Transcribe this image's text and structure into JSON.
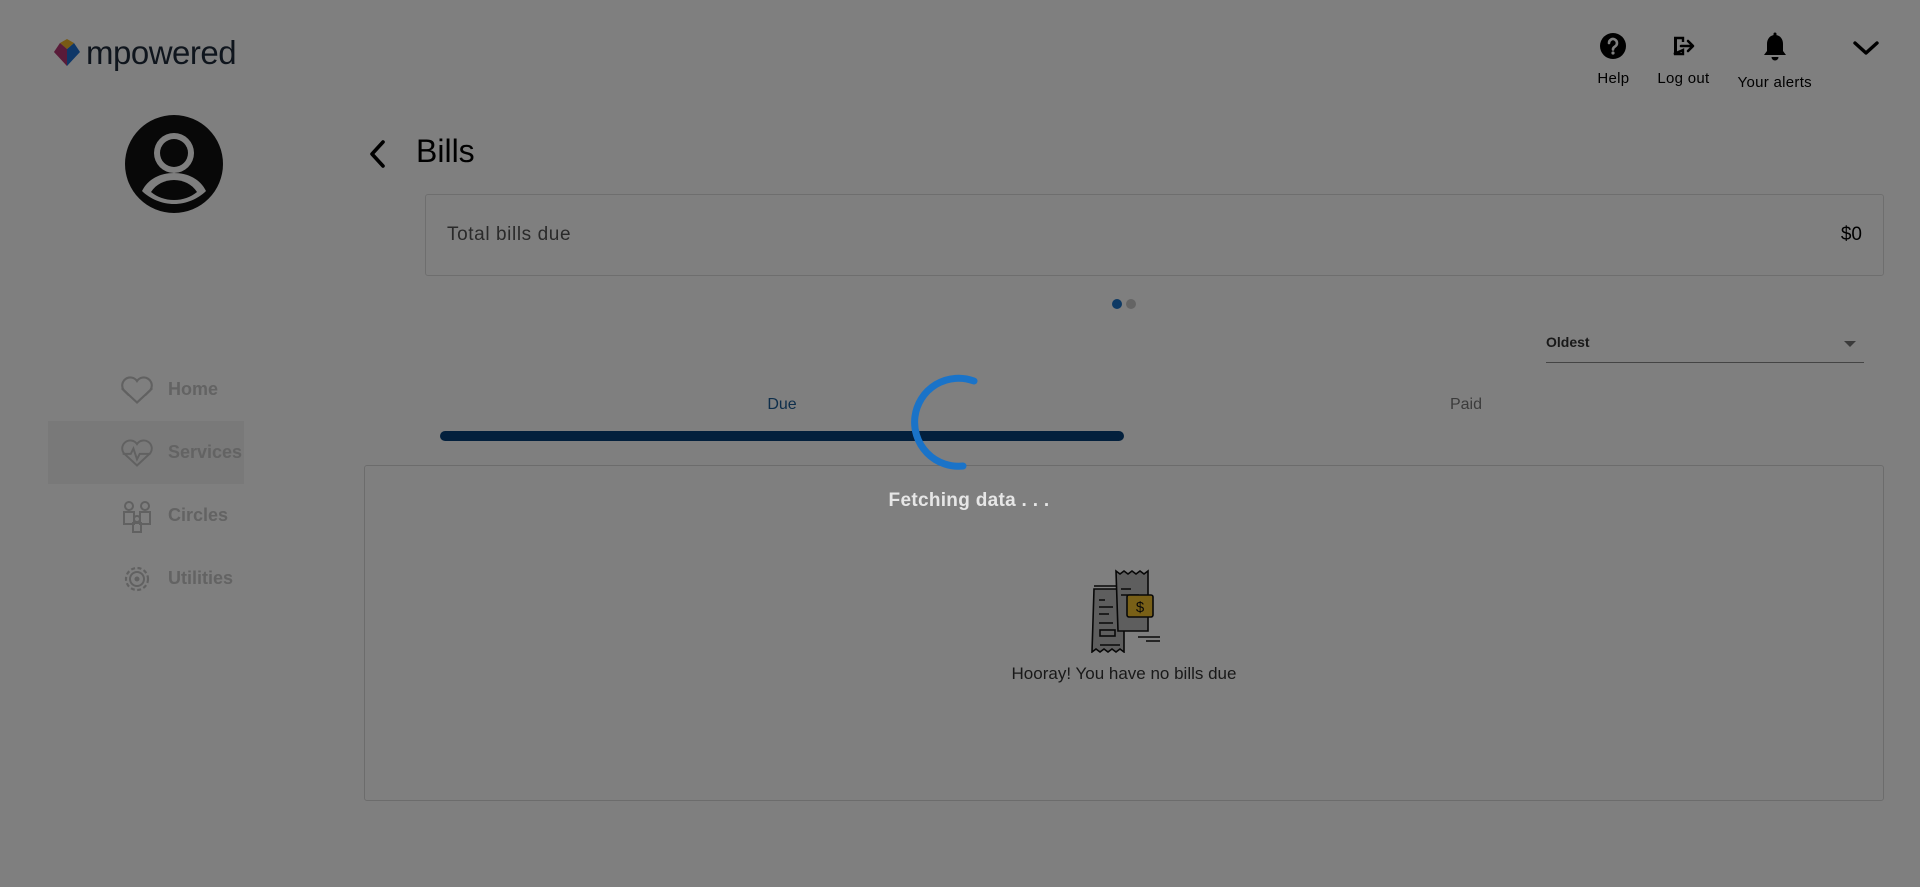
{
  "brand": {
    "name": "mpowered"
  },
  "header": {
    "help_label": "Help",
    "logout_label": "Log out",
    "alerts_label": "Your alerts"
  },
  "sidebar": {
    "items": [
      {
        "label": "Home",
        "icon": "heart-hands-icon"
      },
      {
        "label": "Services",
        "icon": "heart-pulse-icon"
      },
      {
        "label": "Circles",
        "icon": "people-icon"
      },
      {
        "label": "Utilities",
        "icon": "gear-icon"
      }
    ]
  },
  "main": {
    "title": "Bills",
    "total": {
      "label": "Total bills due",
      "value": "$0"
    },
    "sort": {
      "selected": "Oldest"
    },
    "tabs": [
      {
        "label": "Due"
      },
      {
        "label": "Paid"
      }
    ],
    "empty_message": "Hooray! You have no bills due"
  },
  "overlay": {
    "message": "Fetching data . . ."
  },
  "colors": {
    "accent": "#1a73c8",
    "tab_indicator": "#07417a",
    "bill_highlight": "#f2c12e"
  }
}
